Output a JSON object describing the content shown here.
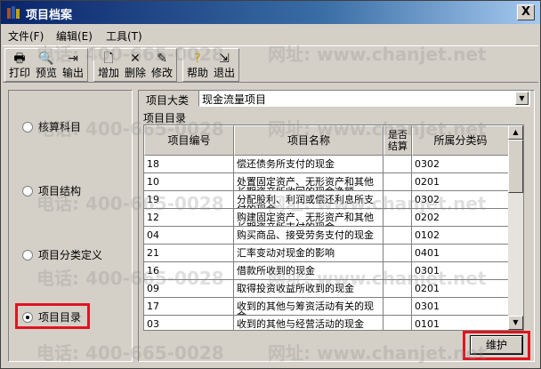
{
  "window": {
    "title": "项目档案",
    "close_label": "X"
  },
  "menu": [
    {
      "label": "文件(F)"
    },
    {
      "label": "编辑(E)"
    },
    {
      "label": "工具(T)"
    }
  ],
  "toolbar": {
    "print": "打印",
    "preview": "预览",
    "export": "输出",
    "add": "增加",
    "delete": "删除",
    "modify": "修改",
    "help": "帮助",
    "exit": "退出"
  },
  "left_options": [
    {
      "label": "核算科目",
      "selected": false
    },
    {
      "label": "项目结构",
      "selected": false
    },
    {
      "label": "项目分类定义",
      "selected": false
    },
    {
      "label": "项目目录",
      "selected": true
    }
  ],
  "category": {
    "label": "项目大类",
    "value": "现金流量项目"
  },
  "catalog_label": "项目目录",
  "columns": [
    "项目编号",
    "项目名称",
    "是否结算",
    "所属分类码"
  ],
  "rows": [
    {
      "code": "18",
      "name": "偿还债务所支付的现金",
      "settled": "",
      "class_code": "0302"
    },
    {
      "code": "10",
      "name": "处置固定资产、无形资产和其他长期资产所收回的现金净额",
      "settled": "",
      "class_code": "0201"
    },
    {
      "code": "19",
      "name": "分配股利、利润或偿还利息所支付的现金",
      "settled": "",
      "class_code": "0302"
    },
    {
      "code": "12",
      "name": "购建固定资产、无形资产和其他长期资产所支付的现金",
      "settled": "",
      "class_code": "0202"
    },
    {
      "code": "04",
      "name": "购买商品、接受劳务支付的现金",
      "settled": "",
      "class_code": "0102"
    },
    {
      "code": "21",
      "name": "汇率变动对现金的影响",
      "settled": "",
      "class_code": "0401"
    },
    {
      "code": "16",
      "name": "借款所收到的现金",
      "settled": "",
      "class_code": "0301"
    },
    {
      "code": "09",
      "name": "取得投资收益所收到的现金",
      "settled": "",
      "class_code": "0201"
    },
    {
      "code": "17",
      "name": "收到的其他与筹资活动有关的现金",
      "settled": "",
      "class_code": "0301"
    },
    {
      "code": "03",
      "name": "收到的其他与经营活动的现金",
      "settled": "",
      "class_code": "0101"
    }
  ],
  "maintain_button": "维护",
  "watermarks": [
    "电话: 400-665-0028",
    "网址: www.chanjet.net"
  ]
}
